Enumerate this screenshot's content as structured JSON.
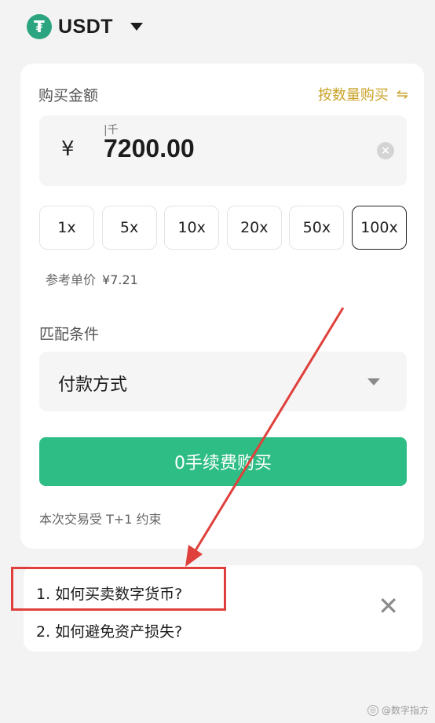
{
  "header": {
    "coin_symbol_glyph": "₮",
    "coin_name": "USDT",
    "coin_icon": "tether-icon",
    "dropdown_icon": "caret-down-icon"
  },
  "form": {
    "amount_label": "购买金额",
    "switch_mode_label": "按数量购买",
    "switch_icon_glyph": "⇋",
    "currency_symbol": "¥",
    "unit_hint": "|千",
    "amount_value": "7200.00",
    "clear_glyph": "×",
    "multipliers": [
      {
        "label": "1x",
        "active": false
      },
      {
        "label": "5x",
        "active": false
      },
      {
        "label": "10x",
        "active": false
      },
      {
        "label": "20x",
        "active": false
      },
      {
        "label": "50x",
        "active": false
      },
      {
        "label": "100x",
        "active": true
      }
    ],
    "ref_price_label": "参考单价",
    "ref_price_value": "¥7.21",
    "match_label": "匹配条件",
    "payment_select": "付款方式",
    "buy_button": "0手续费购买",
    "note": "本次交易受 T+1 约束"
  },
  "faq": {
    "items": [
      "1. 如何买卖数字货币?",
      "2. 如何避免资产损失?"
    ],
    "close_glyph": "✕"
  },
  "annotation": {
    "color": "#e0403b"
  },
  "watermark": {
    "text": "@数字指方"
  },
  "colors": {
    "accent_green": "#2ebd85",
    "tether_green": "#2ba57f",
    "gold": "#c9a227",
    "background": "#f3f3f3"
  }
}
